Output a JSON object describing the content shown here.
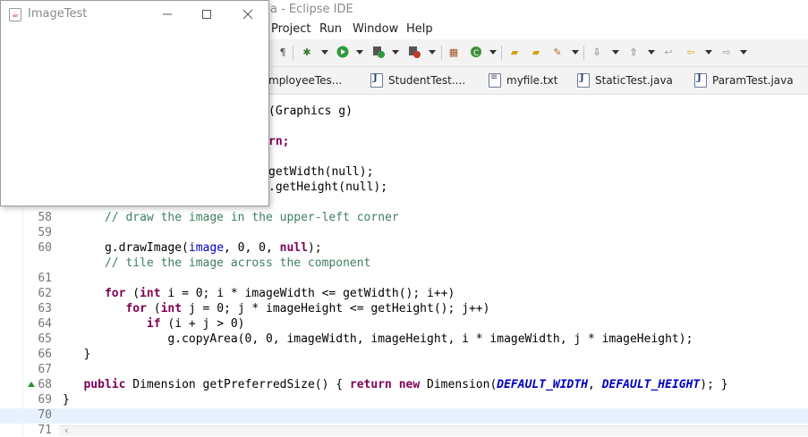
{
  "eclipse": {
    "title": "a - Eclipse IDE",
    "menu": [
      "Project",
      "Run",
      "Window",
      "Help"
    ]
  },
  "tabs": [
    {
      "label": "mployeeTes...",
      "icon": "java-file-icon"
    },
    {
      "label": "StudentTest....",
      "icon": "java-file-icon"
    },
    {
      "label": "myfile.txt",
      "icon": "text-file-icon"
    },
    {
      "label": "StaticTest.java",
      "icon": "java-file-icon"
    },
    {
      "label": "ParamTest.java",
      "icon": "java-file-icon"
    }
  ],
  "code_partial": {
    "l1": "(Graphics g)",
    "l2": "rn;",
    "l3": "getWidth(null);",
    "l4": ".getHeight(null);"
  },
  "code": [
    {
      "n": "58",
      "text": "      // draw the image in the upper-left corner"
    },
    {
      "n": "59",
      "text": ""
    },
    {
      "n": "60",
      "text": "      g.drawImage(image, 0, 0, null);"
    },
    {
      "n": "",
      "text": "      // tile the image across the component"
    },
    {
      "n": "61",
      "text": ""
    },
    {
      "n": "62",
      "text": ""
    },
    {
      "n": "63",
      "text": "      for (int i = 0; i * imageWidth <= getWidth(); i++)"
    },
    {
      "n": "64",
      "text": "         for (int j = 0; j * imageHeight <= getHeight(); j++)"
    },
    {
      "n": "65",
      "text": "            if (i + j > 0)"
    },
    {
      "n": "66",
      "text": "               g.copyArea(0, 0, imageWidth, imageHeight, i * imageWidth, j * imageHeight);"
    },
    {
      "n": "67",
      "text": "   }"
    },
    {
      "n": "68",
      "text": ""
    },
    {
      "n": "69",
      "text": "   public Dimension getPreferredSize() { return new Dimension(DEFAULT_WIDTH, DEFAULT_HEIGHT); }"
    },
    {
      "n": "70",
      "text": "}"
    },
    {
      "n": "71",
      "text": ""
    }
  ],
  "line_numbers": [
    "58",
    "59",
    "60",
    "61",
    "62",
    "63",
    "64",
    "65",
    "66",
    "67",
    "68",
    "69",
    "70",
    "71"
  ],
  "image_window": {
    "title": "ImageTest"
  },
  "colors": {
    "keyword": "#7f0055",
    "comment": "#3f7f5f",
    "field": "#0000c0"
  }
}
